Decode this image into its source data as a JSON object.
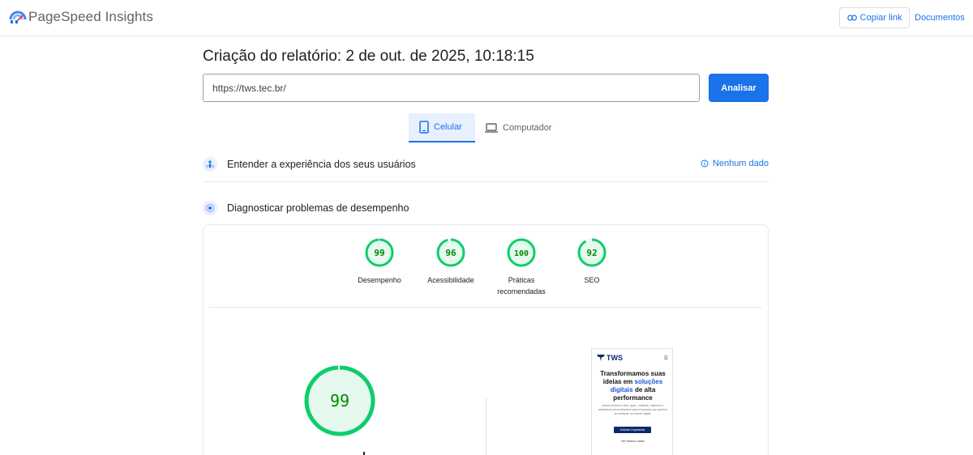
{
  "header": {
    "brand": "PageSpeed Insights",
    "copy_link_label": "Copiar link",
    "docs_label": "Documentos"
  },
  "report": {
    "title": "Criação do relatório: 2 de out. de 2025, 10:18:15",
    "url_value": "https://tws.tec.br/",
    "analyze_label": "Analisar"
  },
  "tabs": [
    {
      "label": "Celular",
      "icon": "smartphone-icon",
      "selected": true
    },
    {
      "label": "Computador",
      "icon": "laptop-icon",
      "selected": false
    }
  ],
  "sections": {
    "experience": {
      "title": "Entender a experiência dos seus usuários",
      "status": "Nenhum dado"
    },
    "diagnose": {
      "title": "Diagnosticar problemas de desempenho"
    }
  },
  "scores": [
    {
      "value": "99",
      "label": "Desempenho",
      "fraction": 0.99
    },
    {
      "value": "96",
      "label": "Acessibilidade",
      "fraction": 0.96
    },
    {
      "value": "100",
      "label": "Práticas recomendadas",
      "fraction": 1.0
    },
    {
      "value": "92",
      "label": "SEO",
      "fraction": 0.92
    }
  ],
  "main_score": {
    "value": "99",
    "fraction": 0.99
  },
  "preview": {
    "logo_text": "TWS",
    "headline_a": "Transformamos suas ideias em",
    "headline_highlight": "soluções digitais",
    "headline_b": "de alta performance",
    "body": "Desenvolvemos sites, apps, chatbots, sistemas e aplicativos personalizados para empresas que querem se destacar no mundo digital.",
    "button": "Solicitar Orçamento",
    "link": "Ver Nossos Cases"
  },
  "colors": {
    "accent": "#1a73e8",
    "pass": "#0cce6b",
    "pass_text": "#008800",
    "pass_fill": "#e6f9ee"
  }
}
